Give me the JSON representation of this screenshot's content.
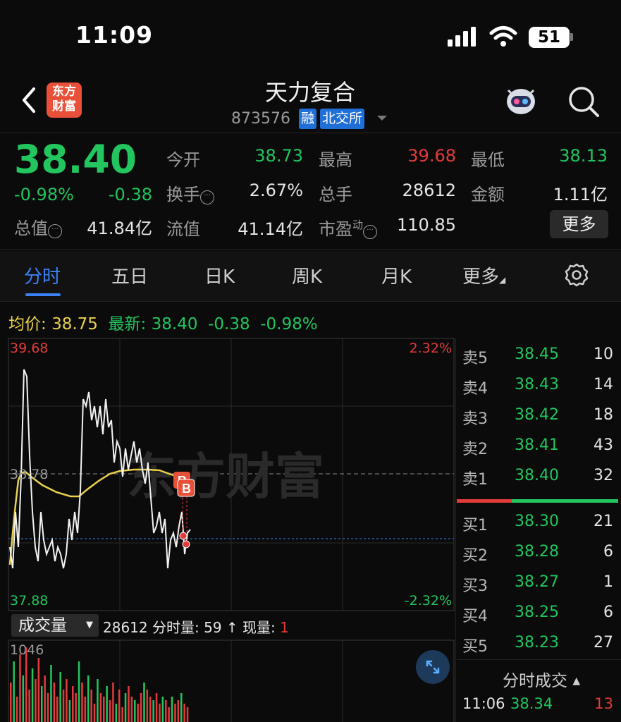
{
  "status_bar": {
    "time": "11:09",
    "battery": "51"
  },
  "header": {
    "stock_name": "天力复合",
    "stock_code": "873576",
    "tag_margin": "融",
    "tag_exchange": "北交所",
    "logo_line1": "东方",
    "logo_line2": "财富"
  },
  "quote": {
    "price": "38.40",
    "change_pct": "-0.98%",
    "change": "-0.38",
    "market_cap_label": "总值",
    "market_cap": "41.84亿",
    "open_label": "今开",
    "open": "38.73",
    "turnover_label": "换手",
    "turnover": "2.67%",
    "float_cap_label": "流值",
    "float_cap": "41.14亿",
    "high_label": "最高",
    "high": "39.68",
    "volume_label": "总手",
    "volume": "28612",
    "pe_label": "市盈",
    "pe_sup": "动",
    "pe": "110.85",
    "low_label": "最低",
    "low": "38.13",
    "amount_label": "金额",
    "amount": "1.11亿",
    "more_label": "更多"
  },
  "tabs": [
    "分时",
    "五日",
    "日K",
    "周K",
    "月K",
    "更多"
  ],
  "info_line": {
    "avg_label": "均价:",
    "avg": "38.75",
    "latest_label": "最新:",
    "latest": "38.40",
    "change": "-0.38",
    "change_pct": "-0.98%"
  },
  "chart": {
    "y_top": "39.68",
    "y_mid": "38.78",
    "y_bottom": "37.88",
    "pct_top": "2.32%",
    "pct_bottom": "-2.32%",
    "watermark": "东方财富",
    "marker_label": "B"
  },
  "order_book": {
    "asks": [
      {
        "label": "卖5",
        "price": "38.45",
        "qty": "10"
      },
      {
        "label": "卖4",
        "price": "38.43",
        "qty": "14"
      },
      {
        "label": "卖3",
        "price": "38.42",
        "qty": "18"
      },
      {
        "label": "卖2",
        "price": "38.41",
        "qty": "43"
      },
      {
        "label": "卖1",
        "price": "38.40",
        "qty": "32"
      }
    ],
    "bids": [
      {
        "label": "买1",
        "price": "38.30",
        "qty": "21"
      },
      {
        "label": "买2",
        "price": "38.28",
        "qty": "6"
      },
      {
        "label": "买3",
        "price": "38.27",
        "qty": "1"
      },
      {
        "label": "买4",
        "price": "38.25",
        "qty": "6"
      },
      {
        "label": "买5",
        "price": "38.23",
        "qty": "27"
      }
    ],
    "ticks_title": "分时成交",
    "tick": {
      "time": "11:06",
      "price": "38.34",
      "qty": "13"
    }
  },
  "volume": {
    "selector": "成交量",
    "total": "28612",
    "minute_label": "分时量:",
    "minute": "59",
    "arrow": "↑",
    "current_label": "现量:",
    "current": "1",
    "y_max": "1046"
  }
}
